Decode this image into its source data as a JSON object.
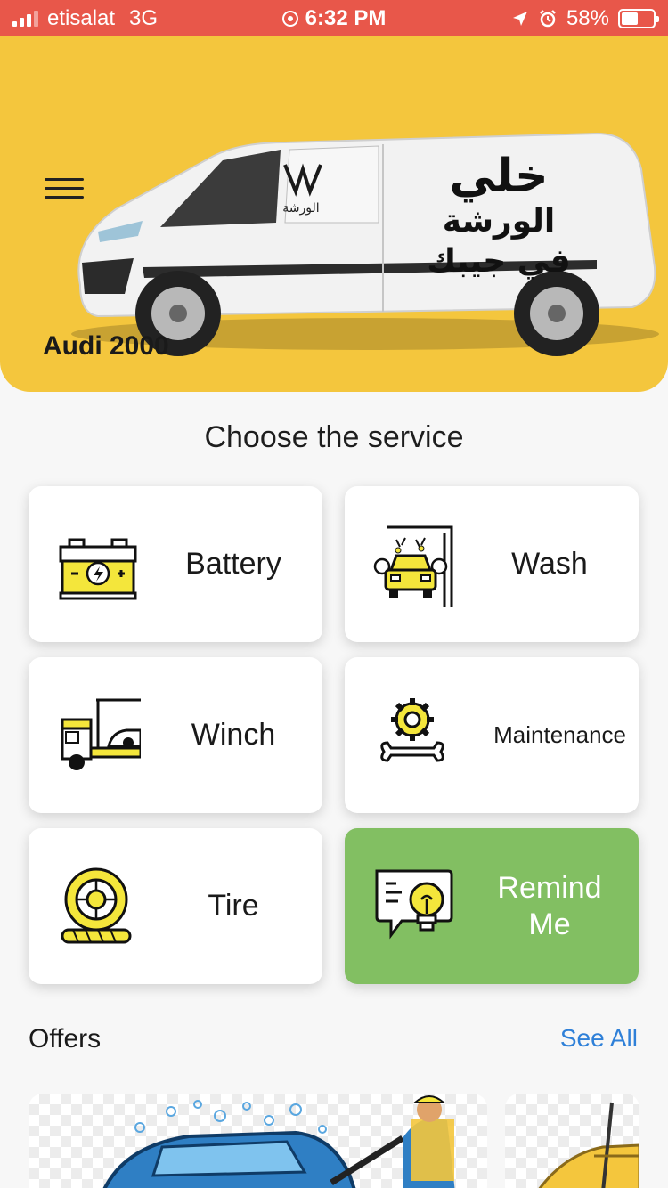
{
  "status_bar": {
    "carrier": "etisalat",
    "network": "3G",
    "time": "6:32 PM",
    "battery_percent": "58%",
    "battery_level": 0.58,
    "signal_bars_active": 3
  },
  "header": {
    "car_name": "Audi 2000",
    "van_text_line1": "خلي",
    "van_text_line2": "الورشة",
    "van_text_line3": "في جيبك",
    "van_logo_text": "الورشة",
    "background_color": "#f4c63d"
  },
  "services": {
    "title": "Choose the service",
    "items": [
      {
        "label": "Battery",
        "icon": "battery-icon"
      },
      {
        "label": "Wash",
        "icon": "car-wash-icon"
      },
      {
        "label": "Winch",
        "icon": "tow-truck-icon"
      },
      {
        "label": "Maintenance",
        "icon": "gear-wrench-icon"
      },
      {
        "label": "Tire",
        "icon": "tire-icon"
      },
      {
        "label": "Remind Me",
        "icon": "lightbulb-chat-icon",
        "highlight_color": "#82bf62"
      }
    ]
  },
  "offers": {
    "title": "Offers",
    "see_all": "See All",
    "link_color": "#2f80d8"
  }
}
